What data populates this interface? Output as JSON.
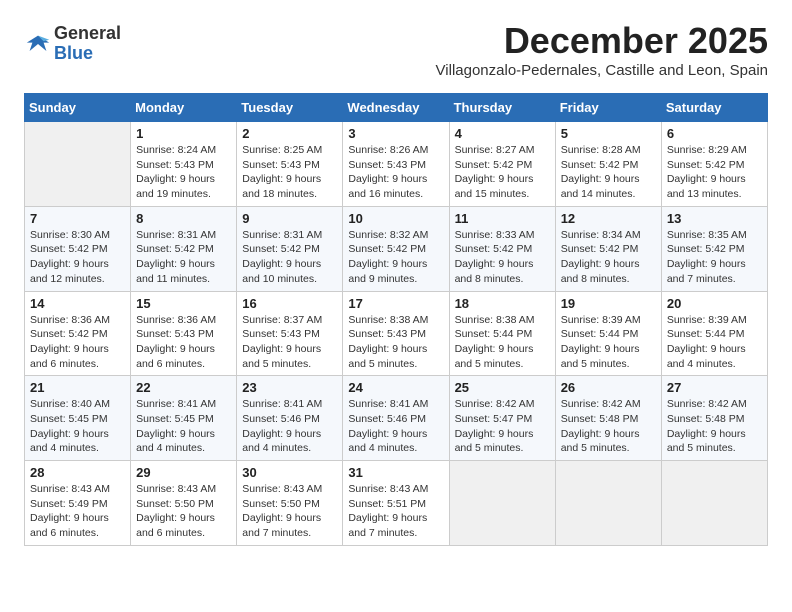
{
  "logo": {
    "general": "General",
    "blue": "Blue"
  },
  "title": "December 2025",
  "subtitle": "Villagonzalo-Pedernales, Castille and Leon, Spain",
  "days_header": [
    "Sunday",
    "Monday",
    "Tuesday",
    "Wednesday",
    "Thursday",
    "Friday",
    "Saturday"
  ],
  "weeks": [
    [
      {
        "day": "",
        "sunrise": "",
        "sunset": "",
        "daylight": ""
      },
      {
        "day": "1",
        "sunrise": "Sunrise: 8:24 AM",
        "sunset": "Sunset: 5:43 PM",
        "daylight": "Daylight: 9 hours and 19 minutes."
      },
      {
        "day": "2",
        "sunrise": "Sunrise: 8:25 AM",
        "sunset": "Sunset: 5:43 PM",
        "daylight": "Daylight: 9 hours and 18 minutes."
      },
      {
        "day": "3",
        "sunrise": "Sunrise: 8:26 AM",
        "sunset": "Sunset: 5:43 PM",
        "daylight": "Daylight: 9 hours and 16 minutes."
      },
      {
        "day": "4",
        "sunrise": "Sunrise: 8:27 AM",
        "sunset": "Sunset: 5:42 PM",
        "daylight": "Daylight: 9 hours and 15 minutes."
      },
      {
        "day": "5",
        "sunrise": "Sunrise: 8:28 AM",
        "sunset": "Sunset: 5:42 PM",
        "daylight": "Daylight: 9 hours and 14 minutes."
      },
      {
        "day": "6",
        "sunrise": "Sunrise: 8:29 AM",
        "sunset": "Sunset: 5:42 PM",
        "daylight": "Daylight: 9 hours and 13 minutes."
      }
    ],
    [
      {
        "day": "7",
        "sunrise": "Sunrise: 8:30 AM",
        "sunset": "Sunset: 5:42 PM",
        "daylight": "Daylight: 9 hours and 12 minutes."
      },
      {
        "day": "8",
        "sunrise": "Sunrise: 8:31 AM",
        "sunset": "Sunset: 5:42 PM",
        "daylight": "Daylight: 9 hours and 11 minutes."
      },
      {
        "day": "9",
        "sunrise": "Sunrise: 8:31 AM",
        "sunset": "Sunset: 5:42 PM",
        "daylight": "Daylight: 9 hours and 10 minutes."
      },
      {
        "day": "10",
        "sunrise": "Sunrise: 8:32 AM",
        "sunset": "Sunset: 5:42 PM",
        "daylight": "Daylight: 9 hours and 9 minutes."
      },
      {
        "day": "11",
        "sunrise": "Sunrise: 8:33 AM",
        "sunset": "Sunset: 5:42 PM",
        "daylight": "Daylight: 9 hours and 8 minutes."
      },
      {
        "day": "12",
        "sunrise": "Sunrise: 8:34 AM",
        "sunset": "Sunset: 5:42 PM",
        "daylight": "Daylight: 9 hours and 8 minutes."
      },
      {
        "day": "13",
        "sunrise": "Sunrise: 8:35 AM",
        "sunset": "Sunset: 5:42 PM",
        "daylight": "Daylight: 9 hours and 7 minutes."
      }
    ],
    [
      {
        "day": "14",
        "sunrise": "Sunrise: 8:36 AM",
        "sunset": "Sunset: 5:42 PM",
        "daylight": "Daylight: 9 hours and 6 minutes."
      },
      {
        "day": "15",
        "sunrise": "Sunrise: 8:36 AM",
        "sunset": "Sunset: 5:43 PM",
        "daylight": "Daylight: 9 hours and 6 minutes."
      },
      {
        "day": "16",
        "sunrise": "Sunrise: 8:37 AM",
        "sunset": "Sunset: 5:43 PM",
        "daylight": "Daylight: 9 hours and 5 minutes."
      },
      {
        "day": "17",
        "sunrise": "Sunrise: 8:38 AM",
        "sunset": "Sunset: 5:43 PM",
        "daylight": "Daylight: 9 hours and 5 minutes."
      },
      {
        "day": "18",
        "sunrise": "Sunrise: 8:38 AM",
        "sunset": "Sunset: 5:44 PM",
        "daylight": "Daylight: 9 hours and 5 minutes."
      },
      {
        "day": "19",
        "sunrise": "Sunrise: 8:39 AM",
        "sunset": "Sunset: 5:44 PM",
        "daylight": "Daylight: 9 hours and 5 minutes."
      },
      {
        "day": "20",
        "sunrise": "Sunrise: 8:39 AM",
        "sunset": "Sunset: 5:44 PM",
        "daylight": "Daylight: 9 hours and 4 minutes."
      }
    ],
    [
      {
        "day": "21",
        "sunrise": "Sunrise: 8:40 AM",
        "sunset": "Sunset: 5:45 PM",
        "daylight": "Daylight: 9 hours and 4 minutes."
      },
      {
        "day": "22",
        "sunrise": "Sunrise: 8:41 AM",
        "sunset": "Sunset: 5:45 PM",
        "daylight": "Daylight: 9 hours and 4 minutes."
      },
      {
        "day": "23",
        "sunrise": "Sunrise: 8:41 AM",
        "sunset": "Sunset: 5:46 PM",
        "daylight": "Daylight: 9 hours and 4 minutes."
      },
      {
        "day": "24",
        "sunrise": "Sunrise: 8:41 AM",
        "sunset": "Sunset: 5:46 PM",
        "daylight": "Daylight: 9 hours and 4 minutes."
      },
      {
        "day": "25",
        "sunrise": "Sunrise: 8:42 AM",
        "sunset": "Sunset: 5:47 PM",
        "daylight": "Daylight: 9 hours and 5 minutes."
      },
      {
        "day": "26",
        "sunrise": "Sunrise: 8:42 AM",
        "sunset": "Sunset: 5:48 PM",
        "daylight": "Daylight: 9 hours and 5 minutes."
      },
      {
        "day": "27",
        "sunrise": "Sunrise: 8:42 AM",
        "sunset": "Sunset: 5:48 PM",
        "daylight": "Daylight: 9 hours and 5 minutes."
      }
    ],
    [
      {
        "day": "28",
        "sunrise": "Sunrise: 8:43 AM",
        "sunset": "Sunset: 5:49 PM",
        "daylight": "Daylight: 9 hours and 6 minutes."
      },
      {
        "day": "29",
        "sunrise": "Sunrise: 8:43 AM",
        "sunset": "Sunset: 5:50 PM",
        "daylight": "Daylight: 9 hours and 6 minutes."
      },
      {
        "day": "30",
        "sunrise": "Sunrise: 8:43 AM",
        "sunset": "Sunset: 5:50 PM",
        "daylight": "Daylight: 9 hours and 7 minutes."
      },
      {
        "day": "31",
        "sunrise": "Sunrise: 8:43 AM",
        "sunset": "Sunset: 5:51 PM",
        "daylight": "Daylight: 9 hours and 7 minutes."
      },
      {
        "day": "",
        "sunrise": "",
        "sunset": "",
        "daylight": ""
      },
      {
        "day": "",
        "sunrise": "",
        "sunset": "",
        "daylight": ""
      },
      {
        "day": "",
        "sunrise": "",
        "sunset": "",
        "daylight": ""
      }
    ]
  ]
}
